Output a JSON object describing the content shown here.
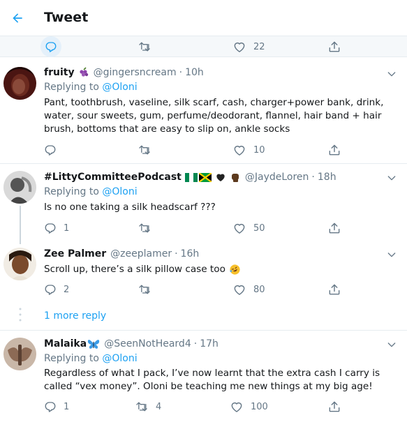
{
  "header": {
    "title": "Tweet"
  },
  "main_tweet_actions": {
    "like_count": "22"
  },
  "replies": [
    {
      "name": "fruity",
      "handle": "@gingersncream",
      "time": "10h",
      "replying_prefix": "Replying to ",
      "replying_to": "@Oloni",
      "text": "Pant, toothbrush, vaseline, silk scarf, cash, charger+power bank, drink, water, sour sweets, gum, perfume/deodorant, flannel, hair band + hair brush, bottoms that are easy to slip on, ankle socks",
      "reply_count": "",
      "retweet_count": "",
      "like_count": "10"
    },
    {
      "name": "#LittyCommitteePodcast",
      "handle": "@JaydeLoren",
      "time": "18h",
      "replying_prefix": "Replying to ",
      "replying_to": "@Oloni",
      "text": "Is no one taking a silk headscarf ???",
      "reply_count": "1",
      "retweet_count": "",
      "like_count": "50"
    },
    {
      "name": "Zee Palmer",
      "handle": "@zeeplamer",
      "time": "16h",
      "text": "Scroll up, there’s a silk pillow case too",
      "reply_count": "2",
      "retweet_count": "",
      "like_count": "80"
    },
    {
      "name": "Malaika",
      "handle": "@SeenNotHeard4",
      "time": "17h",
      "replying_prefix": "Replying to ",
      "replying_to": "@Oloni",
      "text": "Regardless of what I pack, I’ve now learnt that the extra cash I carry is called “vex money”. Oloni be teaching me new things at my big age!",
      "reply_count": "1",
      "retweet_count": "4",
      "like_count": "100"
    }
  ],
  "more_replies": "1 more reply",
  "colors": {
    "accent": "#1da1f2",
    "muted": "#657786",
    "border": "#e6ecf0"
  }
}
